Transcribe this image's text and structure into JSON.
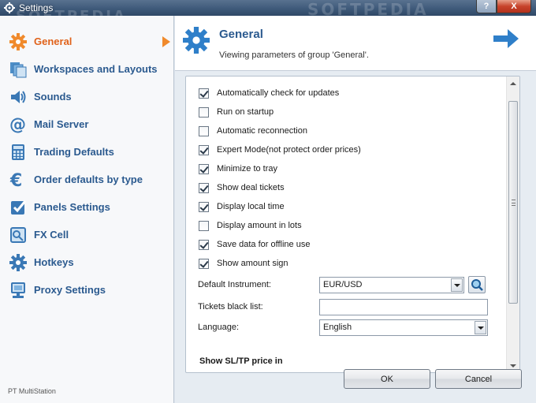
{
  "window": {
    "title": "Settings",
    "watermark": "SOFTPEDIA",
    "help_label": "?",
    "close_label": "X"
  },
  "sidebar": {
    "items": [
      {
        "label": "General",
        "icon": "gear-icon",
        "active": true
      },
      {
        "label": "Workspaces and Layouts",
        "icon": "workspaces-icon"
      },
      {
        "label": "Sounds",
        "icon": "speaker-icon"
      },
      {
        "label": "Mail Server",
        "icon": "at-sign-icon"
      },
      {
        "label": "Trading Defaults",
        "icon": "calculator-icon"
      },
      {
        "label": "Order defaults by type",
        "icon": "euro-icon"
      },
      {
        "label": "Panels Settings",
        "icon": "checkbox-icon"
      },
      {
        "label": "FX Cell",
        "icon": "fx-cell-icon"
      },
      {
        "label": "Hotkeys",
        "icon": "gear-icon"
      },
      {
        "label": "Proxy Settings",
        "icon": "proxy-icon"
      }
    ],
    "footer": "PT MultiStation"
  },
  "header": {
    "title": "General",
    "description": "Viewing parameters of group 'General'."
  },
  "options": [
    {
      "label": "Automatically check for updates",
      "checked": true
    },
    {
      "label": "Run on startup",
      "checked": false
    },
    {
      "label": "Automatic reconnection",
      "checked": false
    },
    {
      "label": "Expert Mode(not protect order prices)",
      "checked": true
    },
    {
      "label": "Minimize to tray",
      "checked": true
    },
    {
      "label": "Show deal tickets",
      "checked": true
    },
    {
      "label": "Display local time",
      "checked": true
    },
    {
      "label": "Display amount in lots",
      "checked": false
    },
    {
      "label": "Save data for offline use",
      "checked": true
    },
    {
      "label": "Show amount sign",
      "checked": true
    }
  ],
  "fields": {
    "default_instrument_label": "Default Instrument:",
    "default_instrument_value": "EUR/USD",
    "tickets_black_list_label": "Tickets black list:",
    "tickets_black_list_value": "",
    "language_label": "Language:",
    "language_value": "English",
    "section_sltp": "Show SL/TP price in"
  },
  "buttons": {
    "ok": "OK",
    "cancel": "Cancel"
  },
  "colors": {
    "accent_blue": "#2b5a8f",
    "accent_orange": "#e0621a"
  }
}
